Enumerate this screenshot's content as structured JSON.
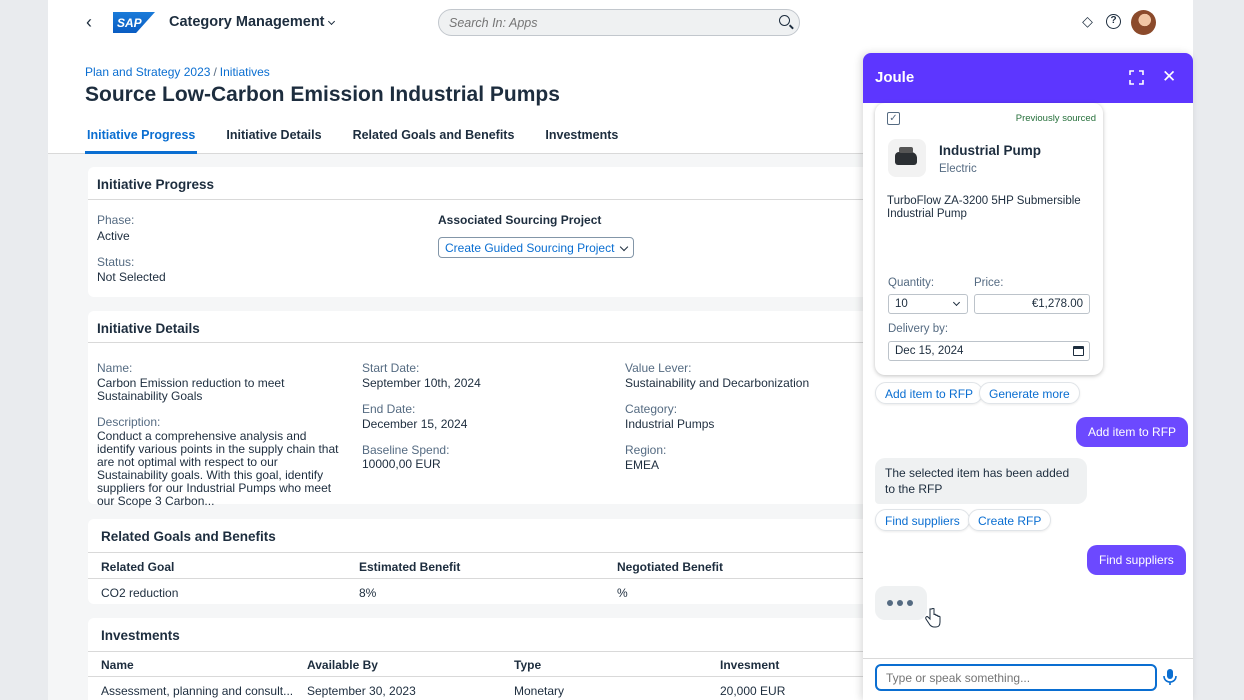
{
  "shell": {
    "app_title": "Category Management",
    "search_placeholder": "Search In: Apps"
  },
  "header": {
    "breadcrumb": [
      "Plan and Strategy 2023",
      "Initiatives"
    ],
    "title": "Source Low-Carbon Emission Industrial Pumps",
    "tabs": [
      "Initiative Progress",
      "Initiative Details",
      "Related Goals and Benefits",
      "Investments"
    ],
    "active_tab": "Initiative Progress"
  },
  "progress": {
    "title": "Initiative Progress",
    "phase_label": "Phase:",
    "phase_value": "Active",
    "status_label": "Status:",
    "status_value": "Not Selected",
    "assoc_label": "Associated Sourcing Project",
    "create_btn": "Create Guided Sourcing Project"
  },
  "details": {
    "title": "Initiative Details",
    "name_label": "Name:",
    "name_value": "Carbon Emission reduction to meet Sustainability Goals",
    "desc_label": "Description:",
    "desc_value": "Conduct a comprehensive analysis and identify various points in the supply chain that are not optimal with respect to our Sustainability goals. With this goal, identify suppliers for our Industrial Pumps who meet our Scope 3 Carbon...",
    "start_label": "Start Date:",
    "start_value": "September 10th, 2024",
    "end_label": "End Date:",
    "end_value": "December 15, 2024",
    "baseline_label": "Baseline Spend:",
    "baseline_value": "10000,00 EUR",
    "lever_label": "Value Lever:",
    "lever_value": "Sustainability and Decarbonization",
    "category_label": "Category:",
    "category_value": "Industrial Pumps",
    "region_label": "Region:",
    "region_value": "EMEA"
  },
  "goals": {
    "title": "Related Goals and Benefits",
    "columns": [
      "Related Goal",
      "Estimated Benefit",
      "Negotiated Benefit"
    ],
    "rows": [
      [
        "CO2 reduction",
        "8%",
        "%"
      ]
    ]
  },
  "investments": {
    "title": "Investments",
    "columns": [
      "Name",
      "Available By",
      "Type",
      "Invesment"
    ],
    "rows": [
      [
        "Assessment, planning and consult...",
        "September 30, 2023",
        "Monetary",
        "20,000 EUR"
      ]
    ]
  },
  "joule": {
    "title": "Joule",
    "card": {
      "badge": "Previously sourced",
      "product_name": "Industrial Pump",
      "product_sub": "Electric",
      "description": "TurboFlow ZA-3200 5HP Submersible Industrial Pump",
      "quantity_label": "Quantity:",
      "quantity_value": "10",
      "price_label": "Price:",
      "price_value": "€1,278.00",
      "delivery_label": "Delivery by:",
      "delivery_value": "Dec 15, 2024"
    },
    "chips1": [
      "Add item to RFP",
      "Generate more"
    ],
    "user_msg1": "Add item to RFP",
    "bot_msg": "The selected item has been added to the RFP",
    "chips2": [
      "Find suppliers",
      "Create RFP"
    ],
    "user_msg2": "Find suppliers",
    "input_placeholder": "Type or speak something..."
  },
  "colors": {
    "accent": "#0a6ed1",
    "joule": "#5d36ff"
  }
}
